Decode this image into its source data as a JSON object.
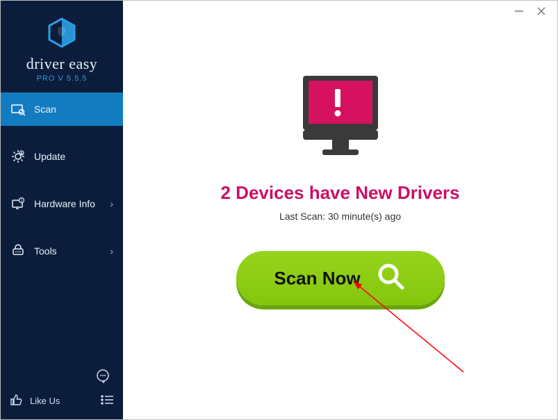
{
  "brand": {
    "name": "driver easy",
    "version": "PRO V 5.5.5"
  },
  "sidebar": {
    "items": [
      {
        "label": "Scan",
        "icon": "scan-icon",
        "active": true,
        "expandable": false
      },
      {
        "label": "Update",
        "icon": "gear-icon",
        "active": false,
        "expandable": false
      },
      {
        "label": "Hardware Info",
        "icon": "hardware-icon",
        "active": false,
        "expandable": true
      },
      {
        "label": "Tools",
        "icon": "tools-icon",
        "active": false,
        "expandable": true
      }
    ],
    "likeus_label": "Like Us"
  },
  "main": {
    "headline": "2 Devices have New Drivers",
    "subline": "Last Scan: 30 minute(s) ago",
    "scan_button_label": "Scan Now"
  },
  "colors": {
    "accent_pink": "#cc0f64",
    "scan_green": "#8fce13",
    "sidebar_bg": "#0b1d3a",
    "active_blue": "#137bc0"
  }
}
